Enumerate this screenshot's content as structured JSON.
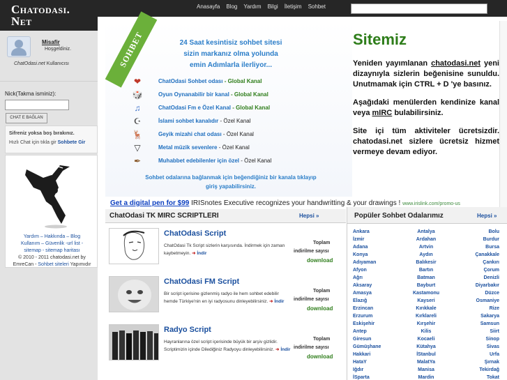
{
  "logo": {
    "line1": "Chatodasi.",
    "line2": "Net"
  },
  "topnav": [
    "Anasayfa",
    "Blog",
    "Yardım",
    "Bilgi",
    "İletişim",
    "Sohbet"
  ],
  "user": {
    "name": "Misafir",
    "welcome": "Hoşgeldiniz.",
    "type_italic": "ChatOdasi.net",
    "type_rest": " Kullanıcısı"
  },
  "login": {
    "label": "Nick(Takma isminiz):",
    "button": "Chat e Bağlan"
  },
  "info": {
    "line1": "Sifreniz yoksa boş bırakınız.",
    "line2_prefix": "Hızlı Chat için tıkla gir ",
    "line2_link": "Sohbete Gir"
  },
  "sidelinks": {
    "l1": "Yardım – Hakkında – Blog",
    "l2": "Kullanım – Güvenlik -url list -",
    "l3": "sitemap - sitemap haritası",
    "l4": "© 2010 - 2011 chatodasi.net by",
    "l5a": "EmreCan - ",
    "l5b": "Sohbet siteleri",
    "l5c": " Yapımıdır"
  },
  "banner": {
    "ribbon": "SOHBET",
    "head1": "24 Saat kesintisiz sohbet sitesi",
    "head2": "sizin markanız olma yolunda",
    "head3": "emin Adımlarla ilerliyor...",
    "channels": [
      {
        "icon": "heart-icon",
        "glyph": "❤",
        "color": "#c0392b",
        "name": "ChatOdasi Sohbet odası",
        "sep": " - ",
        "tag": "Global Kanal",
        "global": true
      },
      {
        "icon": "dice-icon",
        "glyph": "🎲",
        "color": "#c0392b",
        "name": "Oyun Oynanabilir bir kanal",
        "sep": " - ",
        "tag": "Global Kanal",
        "global": true
      },
      {
        "icon": "music-note-icon",
        "glyph": "♫",
        "color": "#3a6fc8",
        "name": "ChatOdasi Fm e Özel Kanal",
        "sep": " - ",
        "tag": "Global Kanal",
        "global": true
      },
      {
        "icon": "prayer-icon",
        "glyph": "☪",
        "color": "#555555",
        "name": "İslami sohbet kanalıdır",
        "sep": " - ",
        "tag": "Özel Kanal",
        "global": false
      },
      {
        "icon": "deer-icon",
        "glyph": "🦌",
        "color": "#8a5a2b",
        "name": "Geyik mizahi chat odası",
        "sep": " - ",
        "tag": "Özel Kanal",
        "global": false
      },
      {
        "icon": "metal-hand-icon",
        "glyph": "▽",
        "color": "#333333",
        "name": "Metal müzik sevenlere",
        "sep": " - ",
        "tag": "Özel Kanal",
        "global": false
      },
      {
        "icon": "quill-icon",
        "glyph": "✒",
        "color": "#8a5a2b",
        "name": "Muhabbet edebilenler için özel",
        "sep": " - ",
        "tag": "Özel Kanal",
        "global": false
      }
    ],
    "foot1": "Sohbet odalarına bağlanmak için beğendiğiniz bir kanala tıklayıp",
    "foot2": "giriş yapabilirsiniz."
  },
  "sitemiz": {
    "title": "Sitemiz",
    "p1_a": "Yeniden yayımlanan ",
    "p1_link": "chatodasi.net",
    "p1_b": " yeni dizaynıyla sizlerin beğenisine sunuldu. Unutmamak için CTRL + D 'ye basınız.",
    "p2_a": "Aşağıdaki menülerden kendinize kanal veya ",
    "p2_link": "mIRC",
    "p2_b": " bulabilirsiniz.",
    "p3": "Site içi tüm aktiviteler ücretsizdir. chatodasi.net sizlere ücretsiz hizmet vermeye devam ediyor."
  },
  "ad": {
    "link": "Get a digital pen for $99",
    "text": " IRISnotes Executive recognizes your handwritting & your drawings ! ",
    "url": "www.irislink.com/promo-us"
  },
  "scripts": {
    "title": "ChatOdasi TK MIRC SCRIPTLERI",
    "all": "Hepsi »",
    "items": [
      {
        "title": "ChatOdasi Script",
        "desc": "ChatOdasi Tk Script sizlerin karşısında. İndirmek için zaman kaybetmeyin.",
        "go": "İndir",
        "stat1": "Toplam",
        "stat2": "indirilme sayısı",
        "download": "indirilme sayısı",
        "dl": "download"
      },
      {
        "title": "ChatOdasi FM Script",
        "desc": "Bir script içerisine gizlenmiş radyo ile hem sohbet edebilir hemde Türkiye'nin en iyi radyosunu dinleyebilirsiniz.",
        "go": "İndir",
        "stat1": "Toplam",
        "stat2": "indirilme sayısı",
        "dl": "download"
      },
      {
        "title": "Radyo Script",
        "desc": "Hayranlarına özel script içerisinde büyük bir arşiv gizlidir. Scriptimizin içinde Dilediğiniz Radyoyu dinleyebilirsiniz.",
        "go": "İndir",
        "stat1": "Toplam",
        "stat2": "indirilme sayısı",
        "dl": "download"
      }
    ]
  },
  "rooms": {
    "title": "Popüler Sohbet Odalarımız",
    "all": "Hepsi »",
    "list": [
      "Ankara",
      "Antalya",
      "Bolu",
      "İzmir",
      "Ardahan",
      "Burdur",
      "Adana",
      "Artvin",
      "Bursa",
      "Konya",
      "Aydın",
      "Çanakkale",
      "Adıyaman",
      "Balıkesir",
      "Çankırı",
      "Afyon",
      "Bartın",
      "Çorum",
      "Ağrı",
      "Batman",
      "Denizli",
      "Aksaray",
      "Bayburt",
      "Diyarbakır",
      "Amasya",
      "Kastamonu",
      "Düzce",
      "Elazığ",
      "Kayseri",
      "Osmaniye",
      "Erzincan",
      "Kırıkkale",
      "Rize",
      "Erzurum",
      "Kırklareli",
      "Sakarya",
      "Eskişehir",
      "Kırşehir",
      "Samsun",
      "Antep",
      "Kilis",
      "Siirt",
      "Giresun",
      "Kocaeli",
      "Sinop",
      "Gümüşhane",
      "Kütahya",
      "Sivas",
      "Hakkari",
      "İStanbul",
      "Urfa",
      "HataY",
      "MalatYa",
      "Şırnak",
      "Iğdır",
      "Manisa",
      "Tekirdağ",
      "İSparta",
      "Mardin",
      "Tokat"
    ]
  }
}
